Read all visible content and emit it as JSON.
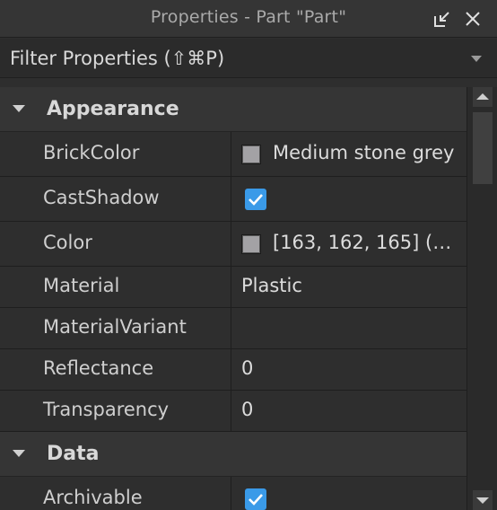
{
  "window": {
    "title": "Properties - Part \"Part\""
  },
  "filter": {
    "placeholder": "Filter Properties (⇧⌘P)"
  },
  "sections": {
    "appearance": {
      "label": "Appearance"
    },
    "data": {
      "label": "Data"
    }
  },
  "properties": {
    "brickcolor": {
      "name": "BrickColor",
      "value": "Medium stone grey",
      "swatch": "#a3a2a5"
    },
    "castshadow": {
      "name": "CastShadow",
      "checked": true
    },
    "color": {
      "name": "Color",
      "value": "[163, 162, 165] (…",
      "swatch": "#a3a2a5"
    },
    "material": {
      "name": "Material",
      "value": "Plastic"
    },
    "materialvariant": {
      "name": "MaterialVariant",
      "value": ""
    },
    "reflectance": {
      "name": "Reflectance",
      "value": "0"
    },
    "transparency": {
      "name": "Transparency",
      "value": "0"
    },
    "archivable": {
      "name": "Archivable",
      "checked": true
    }
  },
  "colors": {
    "accent": "#3a9ae8",
    "background": "#2e2e2e",
    "header": "#353535"
  }
}
